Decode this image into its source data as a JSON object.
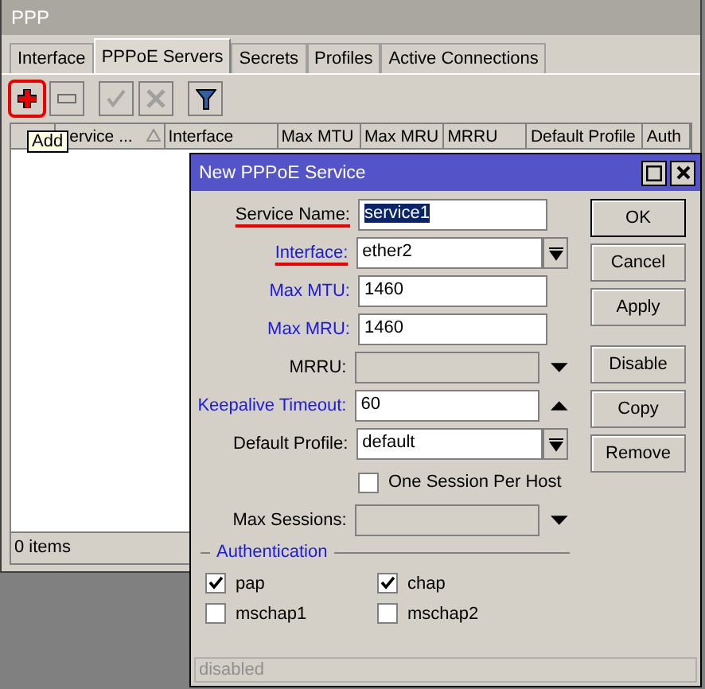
{
  "window": {
    "title": "PPP"
  },
  "tabs": [
    {
      "label": "Interface",
      "selected": false
    },
    {
      "label": "PPPoE Servers",
      "selected": true
    },
    {
      "label": "Secrets",
      "selected": false
    },
    {
      "label": "Profiles",
      "selected": false
    },
    {
      "label": "Active Connections",
      "selected": false
    }
  ],
  "toolbar": [
    {
      "kind": "add",
      "disabled": false,
      "highlighted": true
    },
    {
      "kind": "remove",
      "disabled": false,
      "highlighted": false
    },
    {
      "kind": "enable",
      "disabled": true,
      "highlighted": false
    },
    {
      "kind": "disable",
      "disabled": true,
      "highlighted": false
    },
    {
      "kind": "filter",
      "disabled": false,
      "highlighted": false
    }
  ],
  "tooltip": "Add",
  "table": {
    "columns": [
      {
        "sorted": false
      },
      {
        "label": "ervice ...",
        "sorted": true
      },
      {
        "label": "Interface",
        "sorted": false
      },
      {
        "label": "Max MTU",
        "sorted": false
      },
      {
        "label": "Max MRU",
        "sorted": false
      },
      {
        "label": "MRRU",
        "sorted": false
      },
      {
        "label": "Default Profile",
        "sorted": false
      },
      {
        "label": "Auth",
        "sorted": false
      }
    ]
  },
  "status_bar": "0 items",
  "dialog": {
    "title": "New PPPoE Service",
    "fields": [
      {
        "kind": "text",
        "label": "Service Name:",
        "value": "service1",
        "highlighted": false,
        "underlined": true,
        "selected": true
      },
      {
        "kind": "select",
        "label": "Interface:",
        "value": "ether2",
        "highlighted": true,
        "underlined": true,
        "selected": false
      },
      {
        "kind": "text",
        "label": "Max MTU:",
        "value": "1460",
        "highlighted": true,
        "underlined": false,
        "selected": false
      },
      {
        "kind": "text",
        "label": "Max MRU:",
        "value": "1460",
        "highlighted": true,
        "underlined": false,
        "selected": false
      },
      {
        "kind": "optional",
        "label": "MRRU:",
        "highlighted": false,
        "underlined": false
      },
      {
        "kind": "collapsible",
        "label": "Keepalive Timeout:",
        "value": "60",
        "highlighted": true,
        "underlined": false,
        "selected": false
      },
      {
        "kind": "select",
        "label": "Default Profile:",
        "value": "default",
        "highlighted": false,
        "underlined": false,
        "selected": false
      },
      {
        "kind": "checkbox",
        "label": "One Session Per Host",
        "checked": false
      },
      {
        "kind": "optional",
        "label": "Max Sessions:",
        "highlighted": false,
        "underlined": false
      }
    ],
    "auth": {
      "title": "Authentication",
      "options": [
        {
          "label": "pap",
          "checked": true
        },
        {
          "label": "chap",
          "checked": true
        },
        {
          "label": "mschap1",
          "checked": false
        },
        {
          "label": "mschap2",
          "checked": false
        }
      ]
    },
    "buttons": [
      "OK",
      "Cancel",
      "Apply",
      "Disable",
      "Copy",
      "Remove"
    ],
    "status": "disabled"
  }
}
